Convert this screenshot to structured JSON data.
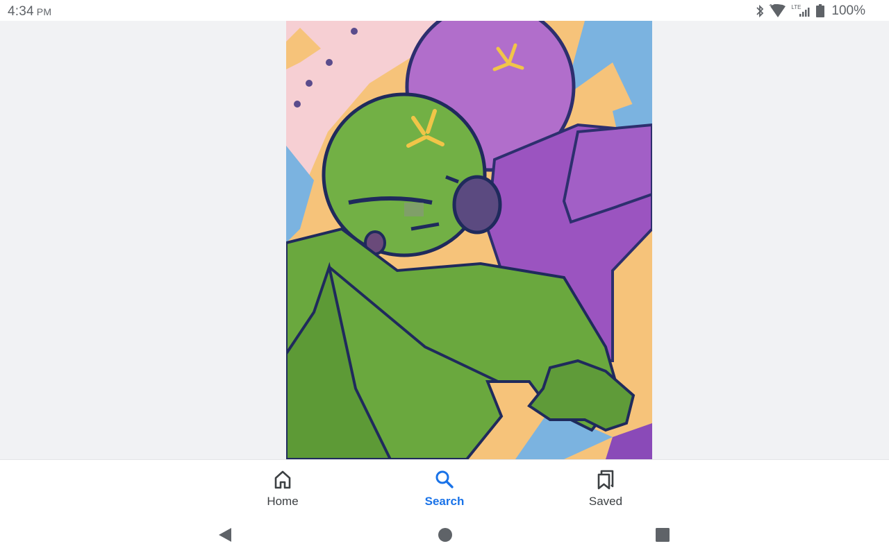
{
  "status_bar": {
    "time": "4:34",
    "ampm": "PM",
    "network_label": "LTE",
    "battery_percent": "100%",
    "icons": [
      "bluetooth-icon",
      "wifi-icon",
      "cell-signal-icon",
      "battery-icon"
    ]
  },
  "bottom_nav": {
    "items": [
      {
        "label": "Home",
        "icon": "home-icon",
        "active": false
      },
      {
        "label": "Search",
        "icon": "search-icon",
        "active": true
      },
      {
        "label": "Saved",
        "icon": "saved-icon",
        "active": false
      }
    ],
    "colors": {
      "active": "#1a73e8",
      "inactive": "#3c4043"
    }
  },
  "system_nav": {
    "buttons": [
      "back-icon",
      "home-circle-icon",
      "recents-icon"
    ]
  }
}
